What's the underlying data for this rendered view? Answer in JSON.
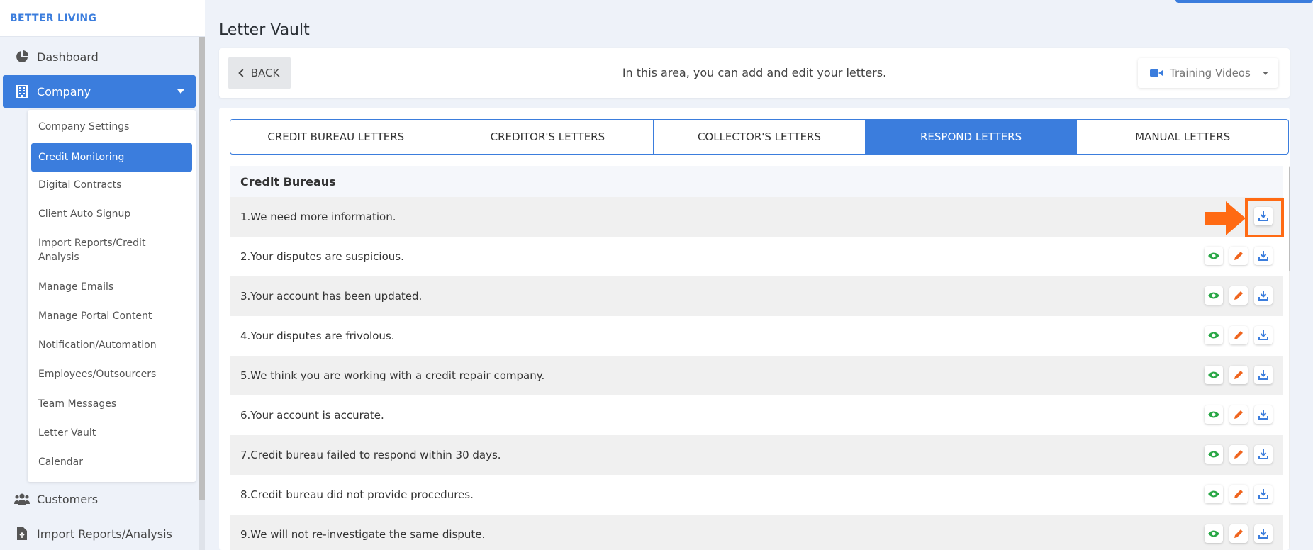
{
  "brand": "BETTER LIVING",
  "sidebar": {
    "dashboard": "Dashboard",
    "company": "Company",
    "submenu": [
      "Company Settings",
      "Credit Monitoring",
      "Digital Contracts",
      "Client Auto Signup",
      "Import Reports/Credit Analysis",
      "Manage Emails",
      "Manage Portal Content",
      "Notification/Automation",
      "Employees/Outsourcers",
      "Team Messages",
      "Letter Vault",
      "Calendar"
    ],
    "customers": "Customers",
    "import_reports": "Import Reports/Analysis"
  },
  "page": {
    "title": "Letter Vault",
    "back": "BACK",
    "header_text": "In this area, you can add and edit your letters.",
    "training_videos": "Training Videos"
  },
  "tabs": [
    "CREDIT BUREAU LETTERS",
    "CREDITOR'S LETTERS",
    "COLLECTOR'S LETTERS",
    "RESPOND LETTERS",
    "MANUAL LETTERS"
  ],
  "section": "Credit Bureaus",
  "letters": [
    "1.We need more information.",
    "2.Your disputes are suspicious.",
    "3.Your account has been updated.",
    "4.Your disputes are frivolous.",
    "5.We think you are working with a credit repair company.",
    "6.Your account is accurate.",
    "7.Credit bureau failed to respond within 30 days.",
    "8.Credit bureau did not provide procedures.",
    "9.We will not re-investigate the same dispute."
  ],
  "colors": {
    "accent": "#3b7ddd",
    "view_icon": "#28a745",
    "edit_icon": "#f0651f",
    "download_icon": "#3b7ddd",
    "annotation": "#ff6a13"
  }
}
